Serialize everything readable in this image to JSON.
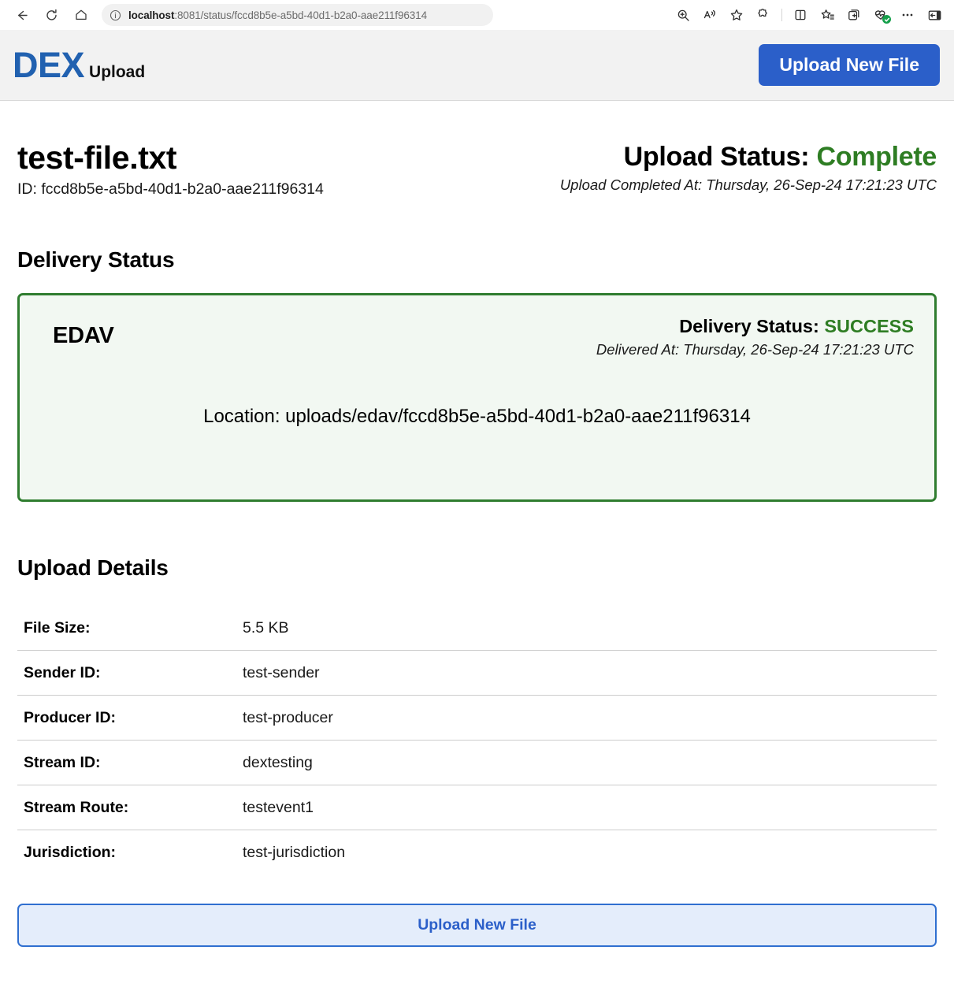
{
  "browser": {
    "nav": [
      {
        "name": "back-button",
        "icon": "arrow-left-icon"
      },
      {
        "name": "refresh-button",
        "icon": "refresh-icon"
      },
      {
        "name": "home-button",
        "icon": "home-icon"
      }
    ],
    "url_host": "localhost",
    "url_rest": ":8081/status/fccd8b5e-a5bd-40d1-b2a0-aae211f96314",
    "url_full": "localhost:8081/status/fccd8b5e-a5bd-40d1-b2a0-aae211f96314",
    "toolbar_icons": [
      "zoom-icon",
      "read-aloud-icon",
      "favorite-star-icon",
      "extensions-icon",
      "split-screen-icon",
      "favorites-list-icon",
      "collections-icon",
      "browser-essentials-icon",
      "settings-more-icon",
      "sidebar-toggle-icon"
    ]
  },
  "header": {
    "brand_main": "DEX",
    "brand_sub": "Upload",
    "upload_button": "Upload New File"
  },
  "file": {
    "name": "test-file.txt",
    "id_label": "ID: fccd8b5e-a5bd-40d1-b2a0-aae211f96314"
  },
  "upload_status": {
    "label": "Upload Status:",
    "value": "Complete",
    "completed_at": "Upload Completed At: Thursday, 26-Sep-24 17:21:23 UTC",
    "color": "#2e7d23"
  },
  "delivery": {
    "section_title": "Delivery Status",
    "target": "EDAV",
    "status_label": "Delivery Status:",
    "status_value": "SUCCESS",
    "delivered_at": "Delivered At: Thursday, 26-Sep-24 17:21:23 UTC",
    "location": "Location: uploads/edav/fccd8b5e-a5bd-40d1-b2a0-aae211f96314",
    "border_color": "#2f7d2f",
    "background_color": "#f2f8f2",
    "status_color": "#2e7d23"
  },
  "details": {
    "section_title": "Upload Details",
    "rows": [
      {
        "label": "File Size:",
        "value": "5.5 KB"
      },
      {
        "label": "Sender ID:",
        "value": "test-sender"
      },
      {
        "label": "Producer ID:",
        "value": "test-producer"
      },
      {
        "label": "Stream ID:",
        "value": "dextesting"
      },
      {
        "label": "Stream Route:",
        "value": "testevent1"
      },
      {
        "label": "Jurisdiction:",
        "value": "test-jurisdiction"
      }
    ]
  },
  "footer": {
    "upload_button": "Upload New File"
  }
}
